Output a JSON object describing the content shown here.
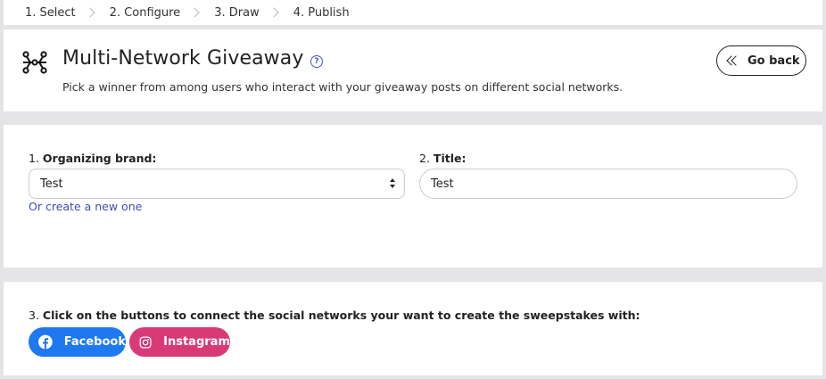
{
  "steps": [
    {
      "label": "1. Select"
    },
    {
      "label": "2. Configure"
    },
    {
      "label": "3. Draw"
    },
    {
      "label": "4. Publish"
    }
  ],
  "header": {
    "title": "Multi-Network Giveaway",
    "help_glyph": "?",
    "subtitle": "Pick a winner from among users who interact with your giveaway posts on different social networks.",
    "go_back_label": "Go back",
    "icon": "hub-network-icon"
  },
  "form": {
    "brand": {
      "number": "1.",
      "label": "Organizing brand:",
      "selected": "Test"
    },
    "create_link": "Or create a new one",
    "title_field": {
      "number": "2.",
      "label": "Title:",
      "value": "Test"
    }
  },
  "networks": {
    "number": "3.",
    "label": "Click on the buttons to connect the social networks your want to create the sweepstakes with:",
    "buttons": [
      {
        "label": "Facebook",
        "icon": "facebook-icon",
        "color": "#1e78f0"
      },
      {
        "label": "Instagram",
        "icon": "instagram-icon",
        "color": "#d83a77"
      }
    ]
  },
  "colors": {
    "link": "#3f4db5",
    "page_bg": "#e4e4e6"
  }
}
